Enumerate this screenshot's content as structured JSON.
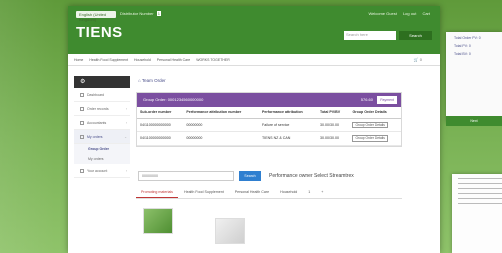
{
  "topbar": {
    "language": "English (United Kingdom)",
    "distributor_label": "Distributor Number",
    "distributor_badge": "1",
    "util_links": [
      "Welcome Guest",
      "Log out",
      "Cart"
    ],
    "logo": "TIENS",
    "search_placeholder": "Search here",
    "search_button": "Search"
  },
  "nav": {
    "items": [
      "Home",
      "Health Food Supplement",
      "Household",
      "Personal Health Care",
      "WORKS TOGETHER"
    ],
    "cart_text": "0"
  },
  "sidebar": {
    "items": [
      {
        "label": "Dashboard"
      },
      {
        "label": "Order records"
      },
      {
        "label": "Accountants"
      },
      {
        "label": "My orders",
        "active": true
      },
      {
        "label": "Your account"
      }
    ],
    "subitems": [
      "Group Order",
      "My orders"
    ]
  },
  "content": {
    "breadcrumb": "Team Order",
    "panel": {
      "group_label": "Group Order:",
      "group_id": "0001234560000000",
      "total": "576.60",
      "pay_button": "Payment"
    },
    "table": {
      "headers": [
        "Sub-order number",
        "Performance attribution number",
        "Performance attribution",
        "Total PV/BV",
        "Group Order Details"
      ],
      "rows": [
        [
          "04/1100000000000",
          "00000000",
          "Failure of service",
          "30.00/30.00",
          "Group Order Details"
        ],
        [
          "04/1100000000000",
          "00000000",
          "TIENS NZ & CAN",
          "30.00/30.00",
          "Group Order Details"
        ]
      ]
    },
    "search": {
      "value": "00000000",
      "button": "Search",
      "title": "Performance owner Select Streamtrex"
    },
    "tabs": [
      "Promoting materials",
      "Health Food Supplement",
      "Personal Health Care",
      "Household",
      "1",
      "+"
    ]
  },
  "side_panel": {
    "lines": [
      "Total Order PV: 0",
      "Total PV: 0",
      "Total BV: 0"
    ],
    "button": "Next"
  },
  "colors": {
    "brand_green": "#3f8b2f",
    "purple": "#7b4fa0",
    "blue": "#2f7fd0"
  }
}
